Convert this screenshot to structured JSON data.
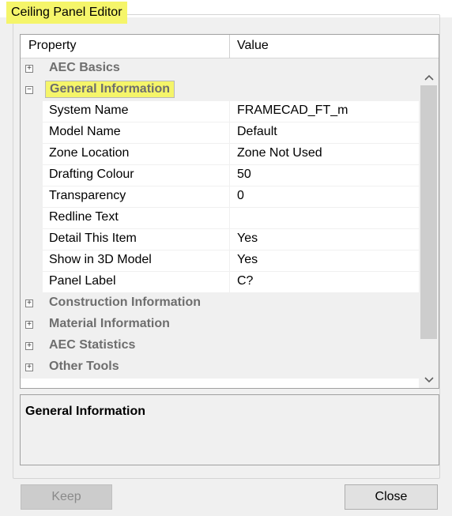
{
  "window": {
    "title": "Ceiling Panel Editor"
  },
  "grid": {
    "headers": {
      "property": "Property",
      "value": "Value"
    },
    "categories": [
      {
        "toggle": "+",
        "label": "AEC Basics"
      },
      {
        "toggle": "−",
        "label": "General Information"
      },
      {
        "toggle": "+",
        "label": "Construction Information"
      },
      {
        "toggle": "+",
        "label": "Material Information"
      },
      {
        "toggle": "+",
        "label": "AEC Statistics"
      },
      {
        "toggle": "+",
        "label": "Other Tools"
      }
    ],
    "properties": [
      {
        "name": "System Name",
        "value": "FRAMECAD_FT_m"
      },
      {
        "name": "Model Name",
        "value": "Default"
      },
      {
        "name": "Zone Location",
        "value": "Zone Not Used"
      },
      {
        "name": "Drafting Colour",
        "value": "50"
      },
      {
        "name": "Transparency",
        "value": "0"
      },
      {
        "name": "Redline Text",
        "value": ""
      },
      {
        "name": "Detail This Item",
        "value": "Yes"
      },
      {
        "name": "Show in 3D Model",
        "value": "Yes"
      },
      {
        "name": "Panel Label",
        "value": "C?"
      }
    ],
    "scrollbar": {
      "up_icon": "chevron-up-icon",
      "down_icon": "chevron-down-icon"
    }
  },
  "description": {
    "title": "General Information"
  },
  "buttons": {
    "keep": "Keep",
    "close": "Close"
  },
  "colors": {
    "highlight": "#f5f56a",
    "category_bg": "#f0f0f0",
    "category_text": "#6e6e6e",
    "scroll_thumb": "#cdcdcd"
  }
}
